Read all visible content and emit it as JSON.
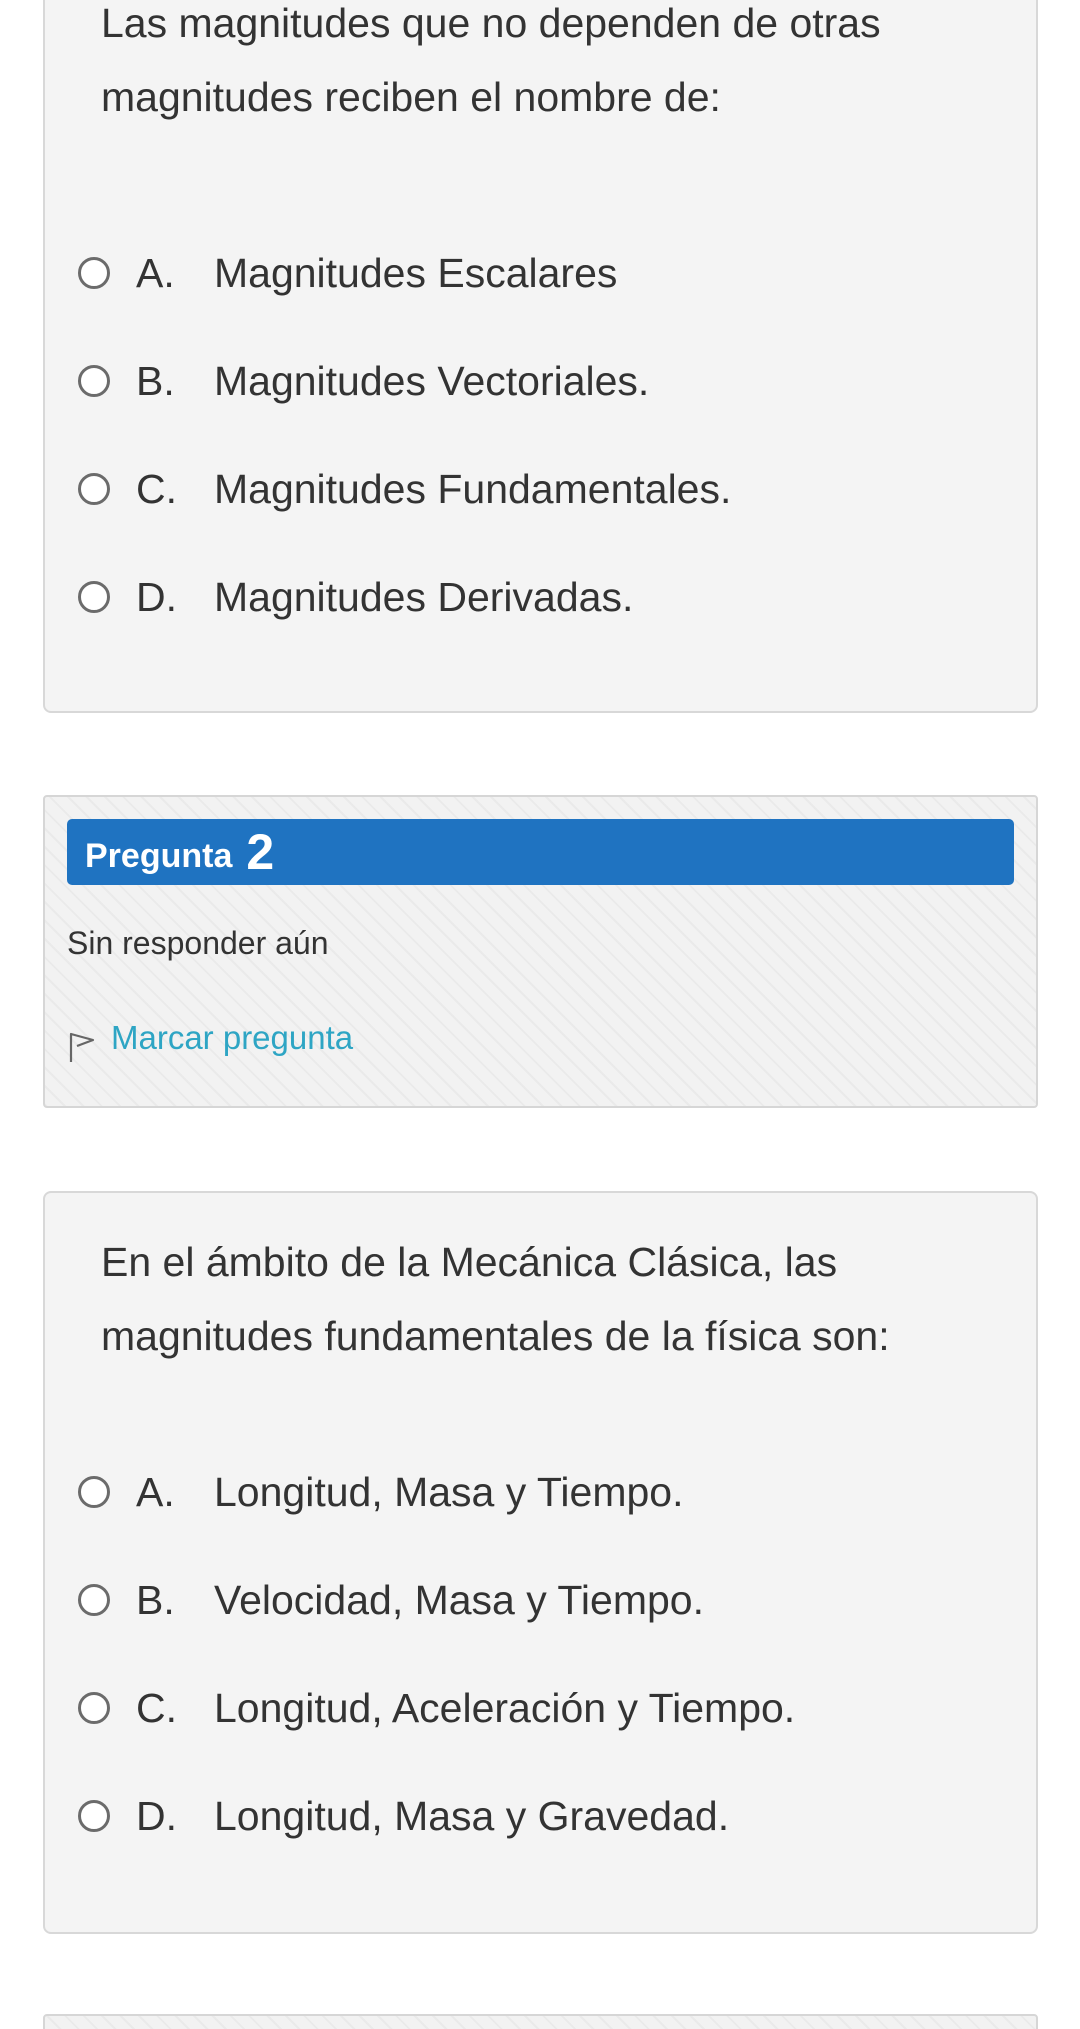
{
  "question1": {
    "text": "Las magnitudes que no dependen de otras magnitudes reciben el nombre de:",
    "answers": [
      {
        "letter": "A.",
        "text": "Magnitudes Escalares"
      },
      {
        "letter": "B.",
        "text": "Magnitudes Vectoriales."
      },
      {
        "letter": "C.",
        "text": "Magnitudes Fundamentales."
      },
      {
        "letter": "D.",
        "text": "Magnitudes Derivadas."
      }
    ]
  },
  "question2_info": {
    "label": "Pregunta",
    "number": "2",
    "status": "Sin responder aún",
    "flag_label": "Marcar pregunta",
    "header_color": "#1f73c1",
    "flag_color": "#2ea5c4",
    "flag_icon": "flag-icon"
  },
  "question2": {
    "text": "En el ámbito de la Mecánica Clásica, las magnitudes fundamentales de la física son:",
    "answers": [
      {
        "letter": "A.",
        "text": "Longitud, Masa y Tiempo."
      },
      {
        "letter": "B.",
        "text": "Velocidad, Masa y Tiempo."
      },
      {
        "letter": "C.",
        "text": "Longitud, Aceleración y Tiempo."
      },
      {
        "letter": "D.",
        "text": "Longitud, Masa y Gravedad."
      }
    ]
  }
}
